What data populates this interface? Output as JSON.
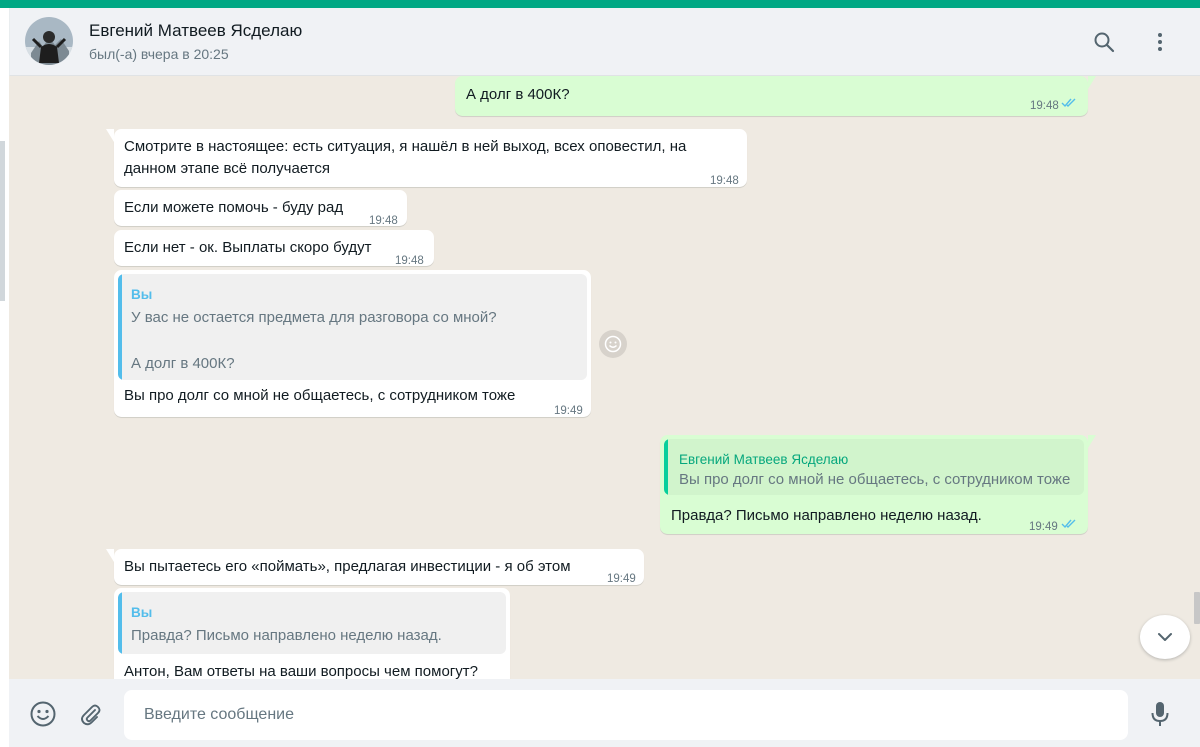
{
  "colors": {
    "accent": "#00a884",
    "incoming_bubble": "#ffffff",
    "outgoing_bubble": "#d9fdd3",
    "chat_background": "#efeae2",
    "header_background": "#f0f2f5",
    "read_ticks": "#53bdeb",
    "quote_you": "#53bdeb",
    "quote_contact": "#06cf9c",
    "quote_contact_name": "#06a77d"
  },
  "header": {
    "contact_name": "Евгений Матвеев Ясделаю",
    "status": "был(-а) вчера в 20:25",
    "icons": [
      "search-icon",
      "menu-icon"
    ]
  },
  "messages": [
    {
      "direction": "out",
      "text": "А долг в 400К?",
      "time": "19:48",
      "read": true
    },
    {
      "direction": "in",
      "lines": [
        "Смотрите в настоящее: есть ситуация, я нашёл в ней выход, всех оповестил, на",
        "данном этапе всё получается"
      ],
      "time": "19:48"
    },
    {
      "direction": "in",
      "text": "Если можете помочь - буду рад",
      "time": "19:48"
    },
    {
      "direction": "in",
      "text": "Если нет - ок. Выплаты скоро будут",
      "time": "19:48"
    },
    {
      "direction": "in",
      "quote": {
        "author": "Вы",
        "lines": [
          "У вас не остается предмета для разговора со мной?",
          "А долг в 400К?"
        ]
      },
      "text": "Вы про долг со мной не общаетесь, с сотрудником тоже",
      "time": "19:49"
    },
    {
      "direction": "out",
      "quote": {
        "author": "Евгений Матвеев Ясделаю",
        "lines": [
          "Вы про долг со мной не общаетесь, с сотрудником тоже"
        ]
      },
      "text": "Правда? Письмо направлено неделю назад.",
      "time": "19:49",
      "read": true
    },
    {
      "direction": "in",
      "text": "Вы пытаетесь его «поймать», предлагая инвестиции - я об этом",
      "time": "19:49"
    },
    {
      "direction": "in",
      "quote": {
        "author": "Вы",
        "lines": [
          "Правда? Письмо направлено неделю назад."
        ]
      },
      "text": "Антон, Вам ответы на ваши вопросы чем помогут?"
    }
  ],
  "chat_icons": [
    "emoji-reaction-icon",
    "chevron-down-icon"
  ],
  "composer": {
    "placeholder": "Введите сообщение",
    "value": "",
    "icons": [
      "emoji-icon",
      "attach-icon",
      "mic-icon"
    ]
  }
}
